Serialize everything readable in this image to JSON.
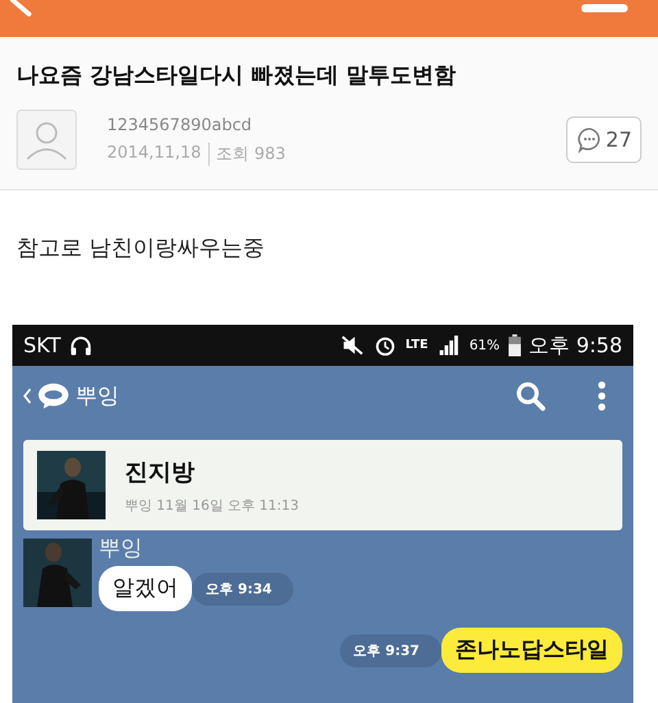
{
  "post": {
    "title": "나요즘 강남스타일다시 빠졌는데 말투도변함",
    "author": "1234567890abcd",
    "date": "2014,11,18",
    "views": "조회 983",
    "comment_count": "27"
  },
  "body": "참고로 남친이랑싸우는중",
  "kakao": {
    "status_bar": {
      "carrier": "SKT",
      "network": "LTE",
      "battery": "61%",
      "time": "오후 9:58"
    },
    "chat_name": "뿌잉",
    "pinned": {
      "title": "진지방",
      "meta": "뿌잉 11월 16일 오후 11:13"
    },
    "messages": [
      {
        "kind": "received",
        "sender": "뿌잉",
        "text": "알겠어",
        "time": "오후 9:34"
      },
      {
        "kind": "sent",
        "text": "존나노답스타일",
        "time": "오후 9:37"
      }
    ]
  }
}
